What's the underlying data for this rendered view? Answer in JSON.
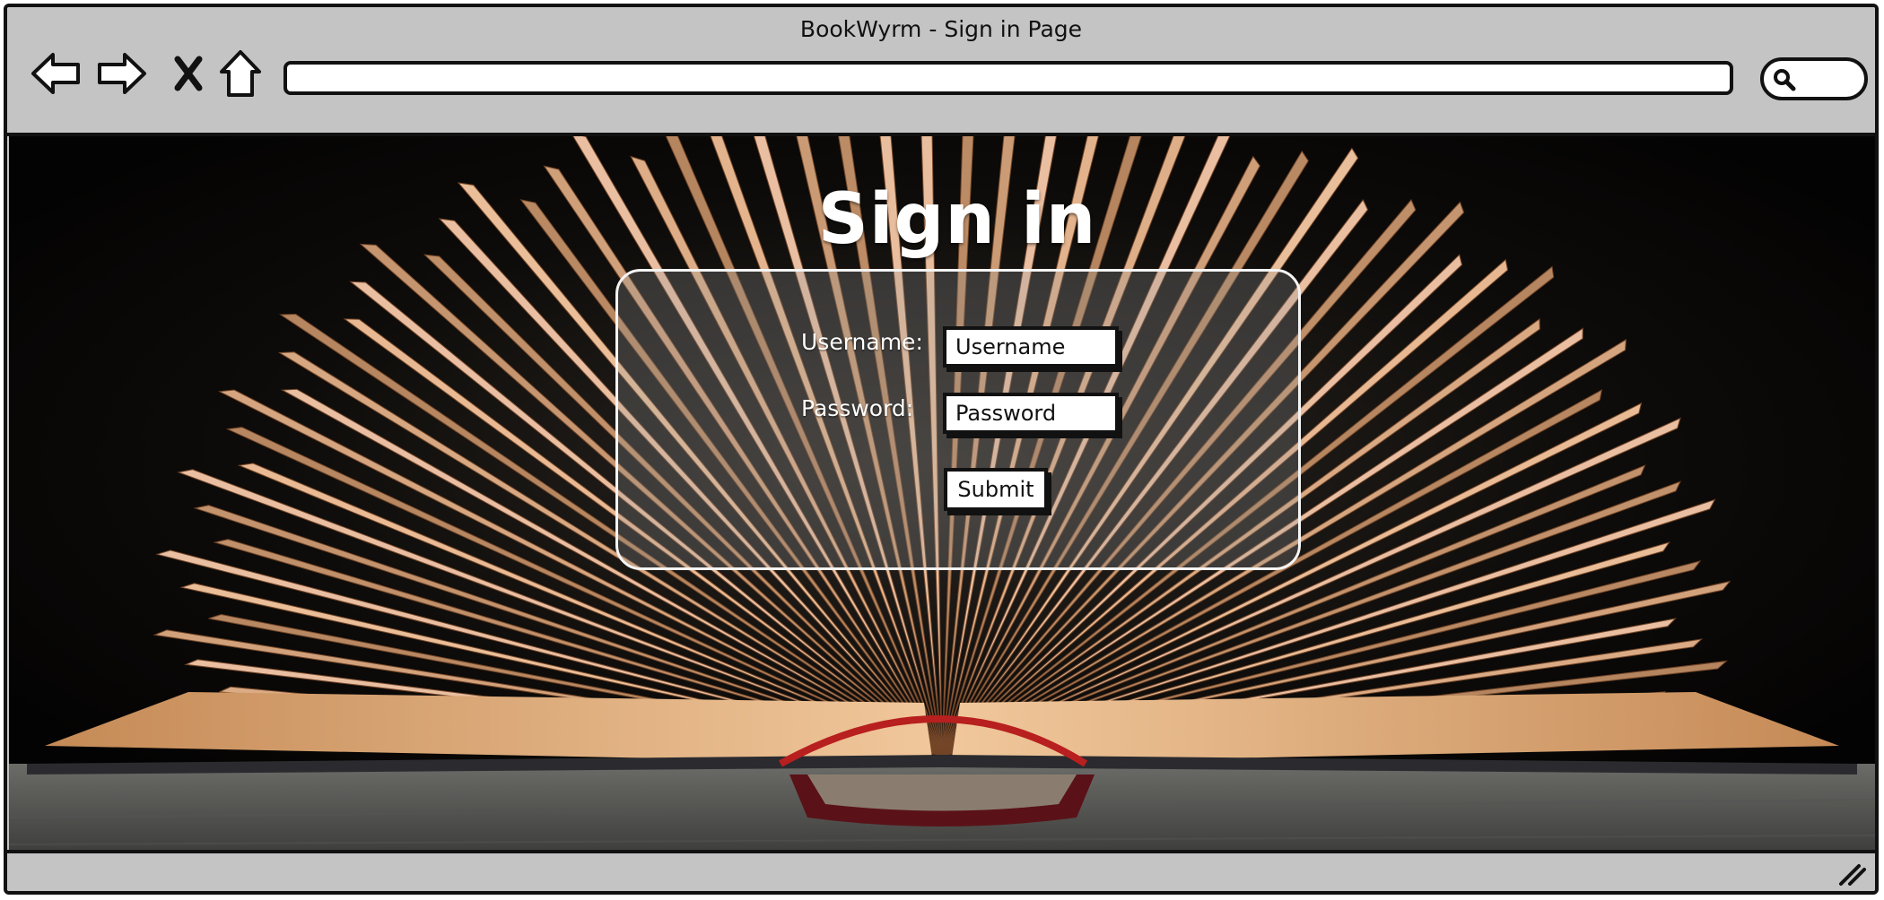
{
  "window": {
    "title": "BookWyrm - Sign in Page",
    "url": ""
  },
  "page": {
    "heading": "Sign in",
    "form": {
      "username_label": "Username:",
      "username_placeholder": "Username",
      "password_label": "Password:",
      "password_placeholder": "Password",
      "submit_label": "Submit"
    }
  },
  "icons": {
    "back": "back-arrow-icon",
    "forward": "forward-arrow-icon",
    "stop": "close-icon",
    "home": "home-icon",
    "search": "search-icon",
    "resize": "resize-grip-icon"
  },
  "colors": {
    "chrome": "#c4c4c4",
    "outline": "#111111",
    "page_bg": "#070605",
    "pages": "#e7a880",
    "headband": "#b81f1f"
  }
}
